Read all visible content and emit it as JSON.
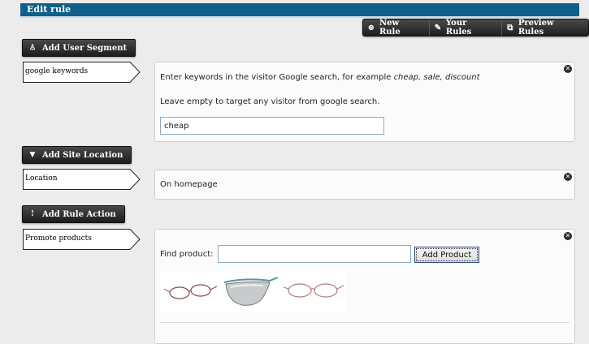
{
  "title": "Edit rule",
  "toolbar": {
    "new_rule": "New Rule",
    "your_rules": "Your Rules",
    "preview_rules": "Preview Rules"
  },
  "sections": {
    "segment": {
      "button": "Add User Segment",
      "label": "google keywords",
      "hint_prefix": "Enter keywords in the visitor Google search, for example ",
      "hint_example": "cheap, sale, discount",
      "hint2": "Leave empty to target any visitor from google search.",
      "value": "cheap"
    },
    "location": {
      "button": "Add Site Location",
      "label": "Location",
      "text": "On homepage"
    },
    "action": {
      "button": "Add Rule Action",
      "label": "Promote products",
      "find_label": "Find product:",
      "find_value": "",
      "add_button": "Add Product"
    }
  },
  "icons": {
    "new_rule": "plus-circle-icon",
    "your_rules": "wrench-icon",
    "preview_rules": "preview-icon",
    "segment": "user-icon",
    "location": "pin-icon",
    "action": "exclamation-icon",
    "close": "close-icon"
  },
  "colors": {
    "titlebar": "#0f5e8b",
    "button": "#2a2a2a"
  }
}
